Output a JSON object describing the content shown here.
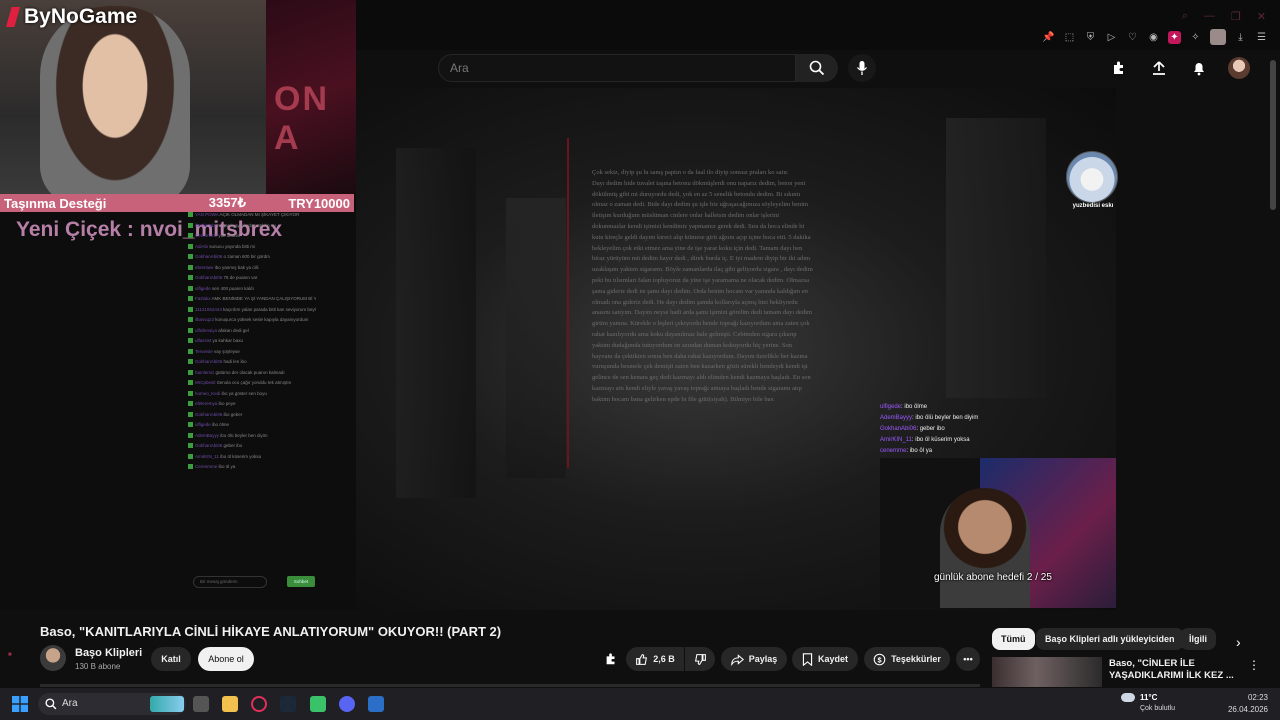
{
  "brand": {
    "name": "ByNoGame"
  },
  "stream_overlay": {
    "support_label": "Taşınma Desteği",
    "support_current": "3357₺",
    "support_goal": "TRY10000",
    "new_follower": "Yeni Çiçek : nvoi_mitsbrex",
    "camera_side_text": "ON A"
  },
  "youtube_header": {
    "search_placeholder": "Ara"
  },
  "document_lines": [
    "Çok sekiz, diyip şu lu sanış paptın o da faal ilo diyip sonsuz praları ko satır.",
    "Dayı dedim bide tuvalet taşına betonu dökmüşlerdi onu naparız dedim, beton yeni",
    "dökülmüş gibi mi duruyordu dedi, yok en az 5 senelik betondu dedim. Bi sıkıntı",
    "olmaz o zaman dedi. Bide dayı dedim şu işle biz uğraşacağımıza söyleyelim benim",
    "iletişim kurduğum müslüman cinlere onlar halletsin dedim onlar işlerini",
    "dokunmazlar kendi işimizi kendimiz yapmamız gerek dedi. Sıra da hoca elinde bi",
    "kutu kireçle geldi dayım kireci alıp kümese girti ağzını açıp içine boca etti. 5 dakika",
    "bekleyelim çok etki etmez ama yine de işe yarar koku için dedi. Tamam dayı ben",
    "biraz yürüyüm mü dedim hayır dedi , direk burda iç. E iyi madem diyip bir iki adım",
    "uzaklaşım yaktım sigaramı. Böyle zamanlarda ilaç gibi geliyordu sigara , dayı dedim",
    "peki bu tılsımları falan topluyoruz da yine işe yaramama ne olacak dedim. Olmazsa",
    "şama gideriz dedi ne şamı dayı dedim. Orda benim hocam var yanında kaldığım en",
    "olmadı ona gideriz dedi. He dayı dedim şamda kollarıyla açmış bizi bekliyordu",
    "anasını satıyım. Dayım neyse hadi arda şamı işimizi görelim dedi tamam dayı dedim",
    "girtim yanına. Kürekle o leşleri çekiyordu bende toprağı kazıyordum ama zaten çok",
    "rahat kazılıyordu ama koku dayanılmaz hale gelmişti. Cebimden sigara çıkarıp",
    "yaktım dudağımda tutuyordum en azından duman kokuyordu hiç yerine. Son",
    "hayvanı da çektikten sonra ben daha rahat kazıyordum. Dayım üzerlikle her kazma",
    "vuruşunda besmele çek demişti zaten ben kazarken gözü sürekli bendeydi kendi işi",
    "gelince de sen kenara geç dedi kazmayı aldı elimden kendi kazmaya başladı. En son",
    "kazmayı attı kendi eliyle yavaş yavaş toprağı atmaya başladı bende sigaramı atıp",
    "baktım hocam bana gelirken epde bi file gitti(siyah). Bilmiyo bile bax"
  ],
  "overlay_chat": [
    {
      "user": "ulfigede",
      "message": ": ibo ölme"
    },
    {
      "user": "AdemBayyy",
      "message": ": ibo ölü beyler ben diyim"
    },
    {
      "user": "GokhanAbi06",
      "message": ": geber ibo"
    },
    {
      "user": "AmirKIN_11",
      "message": ": ibo öl küserim yoksa"
    },
    {
      "user": "cenemme",
      "message": ": ibo öl ya"
    }
  ],
  "second_cam": {
    "goal_text": "günlük abone hedefi 2 / 25"
  },
  "cat_avatar": {
    "name": "yuzbedisi eskı"
  },
  "left_chat": {
    "rows": [
      {
        "user": "YAN POWA",
        "message": "AÇIK OLMADAN MI ŞİKAYET ÇIKIYOR"
      },
      {
        "user": "ibrahimabi",
        "message": "ne yani yayınlardan atıldın mı"
      },
      {
        "user": "Cerenmme",
        "message": "yok abudin"
      },
      {
        "user": "AdiAbi",
        "message": "sunucu yayında bitti mi"
      },
      {
        "user": "GokhanAbi06",
        "message": "o zaman 600 bir gördm"
      },
      {
        "user": "ebrentwe",
        "message": "ibo yanmış bak ya cilli"
      },
      {
        "user": "GokhanAbi06",
        "message": "76 de puanın var"
      },
      {
        "user": "ulfigede",
        "message": "sen 400 puanın kaldı"
      },
      {
        "user": "Fazlalıx",
        "message": "AMK BENİMDE YA Şİ YANDAN ÇALIŞIYORUM Bİ YANDAN İZLİYORUM"
      },
      {
        "user": "11121062444",
        "message": "kaçırdım yalan parada bitti kan seviyorum beyler aklıma anlamak"
      },
      {
        "user": "ilbasvq23",
        "message": "konuşurca yüksek sesle kapıyla dayanıyordum"
      },
      {
        "user": "ulfsilensiya",
        "message": "afakan dedi gel"
      },
      {
        "user": "ulfassist",
        "message": "ya kahkar baxu"
      },
      {
        "user": "Terseisie",
        "message": "vay şöyleyse"
      },
      {
        "user": "GokhanAbi06",
        "message": "hadi len ibo"
      },
      {
        "user": "hamlemiz",
        "message": "gütümo der olacak puanın kalmadı"
      },
      {
        "user": "MrCpbesit",
        "message": "Senola ocu çağır yoruldu tek atmıştın"
      },
      {
        "user": "homeo_Kedi",
        "message": "ibo ya göster sen boyu"
      },
      {
        "user": "efeleremya",
        "message": "ibo peye"
      },
      {
        "user": "GokhanAbi06",
        "message": "ibo geber"
      },
      {
        "user": "ulfigede",
        "message": "ibo ölme"
      },
      {
        "user": "AdemBayyy",
        "message": "ibo ölü beyler ben diyim"
      },
      {
        "user": "GokhanAbi06",
        "message": "geber ibo"
      },
      {
        "user": "AmirKIN_11",
        "message": "ibo öl küserim yoksa"
      },
      {
        "user": "Cerenmme",
        "message": "ibo öl ya"
      }
    ],
    "input_placeholder": "Bir mesaj gönderin",
    "send_label": "Sohbet"
  },
  "video": {
    "title": "Baso, \"KANITLARIYLA CİNLİ HİKAYE ANLATIYORUM\" OKUYOR!! (PART 2)",
    "channel_name": "Başo Klipleri",
    "subscribers": "130 B abone",
    "join_label": "Katıl",
    "subscribe_label": "Abone ol",
    "likes": "2,6 B",
    "share_label": "Paylaş",
    "save_label": "Kaydet",
    "thanks_label": "Teşekkürler"
  },
  "filters": [
    "Tümü",
    "Başo Klipleri adlı yükleyiciden",
    "İlgili"
  ],
  "recommendation": {
    "title": "Baso, \"CİNLER İLE YAŞADIKLARIMI İLK KEZ ..."
  },
  "taskbar": {
    "search_placeholder": "Ara",
    "temperature": "11°C",
    "weather": "Çok bulutlu",
    "time": "02:23",
    "date": "26.04.2026"
  },
  "colors": {
    "support_bar": "#c8627a",
    "follower_text": "#b67fa8",
    "subscribe_bg": "#f1f1f1",
    "chip_bg": "#272727"
  }
}
